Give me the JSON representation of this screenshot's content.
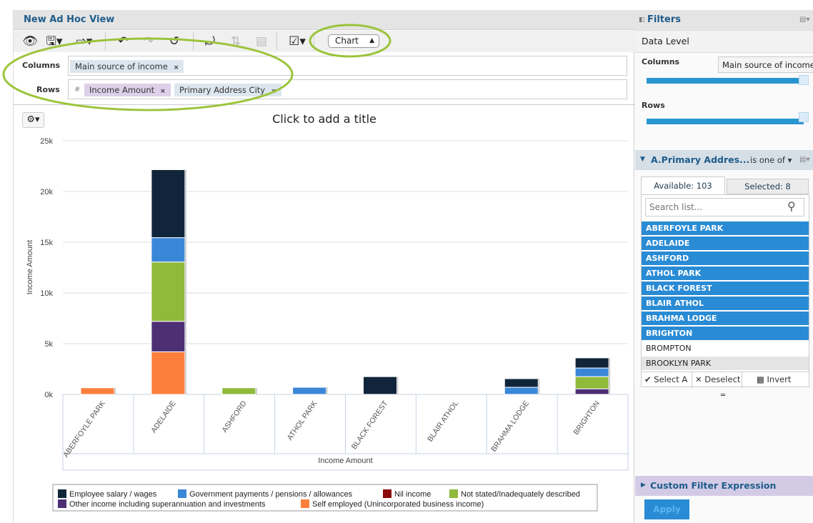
{
  "view": {
    "title": "New Ad Hoc View",
    "mode_select": "Chart"
  },
  "toolbar": {
    "icons": [
      "eye-icon",
      "save-icon",
      "export-icon",
      "undo-icon",
      "redo-icon",
      "undo-all-icon",
      "pivot-icon",
      "sort-icon",
      "sql-icon",
      "display-options-icon"
    ]
  },
  "columns": {
    "label": "Columns",
    "items": [
      {
        "label": "Main source of income",
        "remove": "×"
      }
    ]
  },
  "rows": {
    "label": "Rows",
    "hash": "#",
    "items": [
      {
        "label": "Income Amount",
        "remove": "×"
      },
      {
        "label": "Primary Address City",
        "remove": "×"
      }
    ]
  },
  "chart_title": "Click to add a title",
  "chart_data": {
    "type": "bar",
    "stacked": true,
    "title": "Click to add a title",
    "ylabel": "Income Amount",
    "xlabel": "Income Amount",
    "ylim": [
      0,
      25000
    ],
    "yticks": [
      "0k",
      "5k",
      "10k",
      "15k",
      "20k",
      "25k"
    ],
    "ytick_values": [
      0,
      5000,
      10000,
      15000,
      20000,
      25000
    ],
    "grid": true,
    "legend": "bottom",
    "categories": [
      "ABERFOYLE PARK",
      "ADELAIDE",
      "ASHFORD",
      "ATHOL PARK",
      "BLACK FOREST",
      "BLAIR ATHOL",
      "BRAHMA LODGE",
      "BRIGHTON"
    ],
    "series": [
      {
        "name": "Self employed (Unincorporated business income)",
        "color": "#fd7f3c",
        "values": [
          650,
          4200,
          0,
          0,
          0,
          0,
          0,
          0
        ]
      },
      {
        "name": "Other income including superannuation and investments",
        "color": "#4d2f73",
        "values": [
          0,
          3000,
          0,
          0,
          0,
          0,
          0,
          550
        ]
      },
      {
        "name": "Not stated/Inadequately described",
        "color": "#8fba3a",
        "values": [
          0,
          5850,
          650,
          0,
          0,
          0,
          0,
          1200
        ]
      },
      {
        "name": "Nil income",
        "color": "#8b0a0a",
        "values": [
          0,
          0,
          0,
          0,
          0,
          0,
          0,
          0
        ]
      },
      {
        "name": "Government payments / pensions / allowances",
        "color": "#3a87d8",
        "values": [
          0,
          2400,
          0,
          700,
          0,
          0,
          700,
          850
        ]
      },
      {
        "name": "Employee salary / wages",
        "color": "#10253a",
        "values": [
          0,
          6700,
          0,
          0,
          1750,
          0,
          850,
          1000
        ]
      }
    ],
    "legend_order": [
      "Employee salary / wages",
      "Government payments / pensions / allowances",
      "Nil income",
      "Not stated/Inadequately described",
      "Other income including superannuation and investments",
      "Self employed (Unincorporated business income)"
    ]
  },
  "filters": {
    "title": "Filters",
    "data_level": "Data Level",
    "columns_label": "Columns",
    "columns_tooltip": "Main source of income",
    "rows_label": "Rows",
    "filter_name": "A.Primary Addres...",
    "operator": "is one of",
    "tab_available": "Available: 103",
    "tab_selected": "Selected: 8",
    "search_placeholder": "Search list...",
    "items": [
      {
        "label": "ABERFOYLE PARK",
        "selected": true
      },
      {
        "label": "ADELAIDE",
        "selected": true
      },
      {
        "label": "ASHFORD",
        "selected": true
      },
      {
        "label": "ATHOL PARK",
        "selected": true
      },
      {
        "label": "BLACK FOREST",
        "selected": true
      },
      {
        "label": "BLAIR ATHOL",
        "selected": true
      },
      {
        "label": "BRAHMA LODGE",
        "selected": true
      },
      {
        "label": "BRIGHTON",
        "selected": true
      },
      {
        "label": "BROMPTON",
        "selected": false
      },
      {
        "label": "BROOKLYN PARK",
        "selected": false
      }
    ],
    "select_all": "Select A",
    "deselect": "Deselect",
    "invert": "Invert",
    "custom_expression": "Custom Filter Expression",
    "apply": "Apply"
  },
  "colors": {
    "accent": "#2a8bd5",
    "title": "#1e5c8a",
    "highlight_ring": "#9cc43c"
  }
}
